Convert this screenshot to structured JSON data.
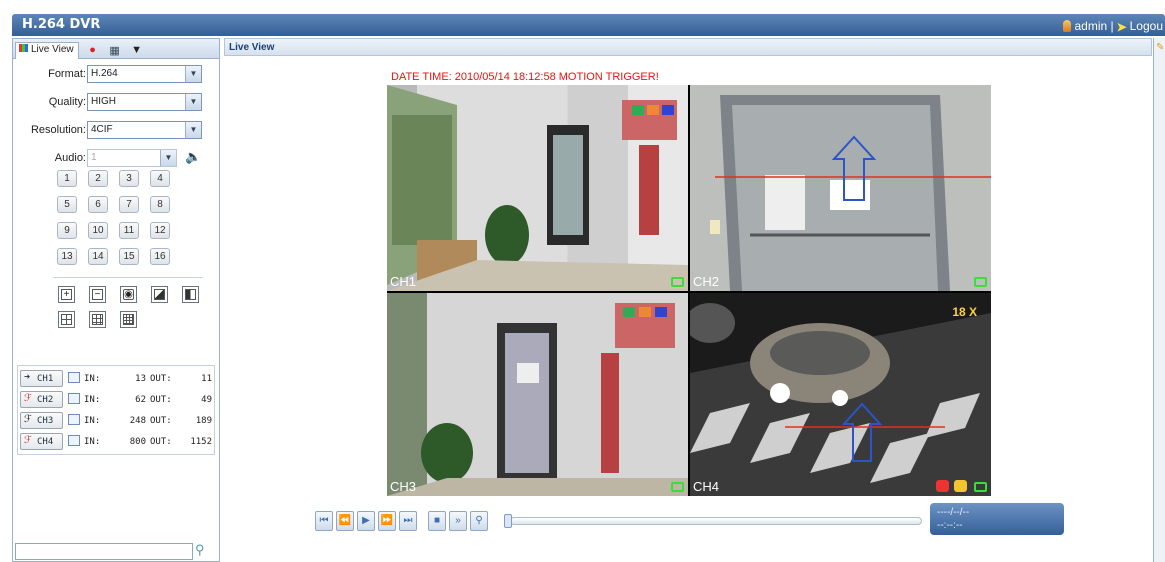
{
  "app": {
    "title": "H.264 DVR",
    "user": "admin",
    "separator": "|",
    "logout": "Logou"
  },
  "tabs": {
    "live": "Live View"
  },
  "settings": {
    "format_label": "Format:",
    "format_value": "H.264",
    "quality_label": "Quality:",
    "quality_value": "HIGH",
    "resolution_label": "Resolution:",
    "resolution_value": "4CIF",
    "audio_label": "Audio:",
    "audio_value": "1"
  },
  "channel_buttons": [
    "1",
    "2",
    "3",
    "4",
    "5",
    "6",
    "7",
    "8",
    "9",
    "10",
    "11",
    "12",
    "13",
    "14",
    "15",
    "16"
  ],
  "channels": [
    {
      "name": "CH1",
      "in_label": "IN:",
      "in": "13",
      "out_label": "OUT:",
      "out": "11"
    },
    {
      "name": "CH2",
      "in_label": "IN:",
      "in": "62",
      "out_label": "OUT:",
      "out": "49"
    },
    {
      "name": "CH3",
      "in_label": "IN:",
      "in": "248",
      "out_label": "OUT:",
      "out": "189"
    },
    {
      "name": "CH4",
      "in_label": "IN:",
      "in": "800",
      "out_label": "OUT:",
      "out": "1152"
    }
  ],
  "main": {
    "header": "Live View",
    "overlay_text": "DATE TIME: 2010/05/14 18:12:58     MOTION TRIGGER!",
    "cameras": [
      {
        "label": "CH1"
      },
      {
        "label": "CH2"
      },
      {
        "label": "CH3"
      },
      {
        "label": "CH4",
        "zoom": "18 X"
      }
    ]
  },
  "playback": {
    "date_display": "----/--/--",
    "time_display": "--:--:--"
  },
  "colors": {
    "titlebar": "#3d6aa4",
    "accent": "#1a3f75",
    "overlay_text": "#e11111",
    "record_icon": "#3cdc3c"
  }
}
